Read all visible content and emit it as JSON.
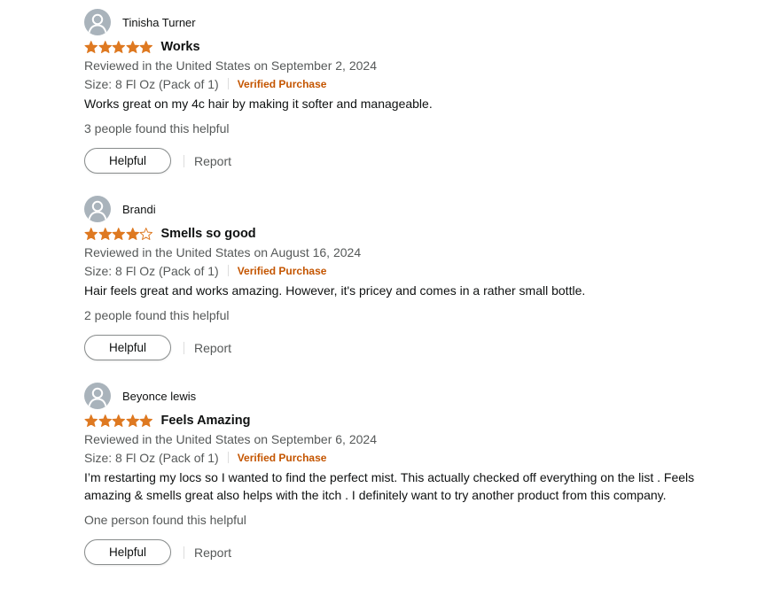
{
  "colors": {
    "star_fill": "#de7921",
    "verified": "#c45500",
    "avatar": "#a9b3bb",
    "secondary_text": "#565959"
  },
  "reviews": [
    {
      "profile_name": "Tinisha Turner",
      "avatar_icon": "user-silhouette-icon",
      "rating": 5,
      "title": "Works",
      "date": "Reviewed in the United States on September 2, 2024",
      "variant": "Size: 8 Fl Oz (Pack of 1)",
      "verified_label": "Verified Purchase",
      "body": "Works great on my 4c hair by making it softer and manageable.",
      "helpful_count": "3 people found this helpful",
      "helpful_label": "Helpful",
      "report_label": "Report"
    },
    {
      "profile_name": "Brandi",
      "avatar_icon": "user-silhouette-icon",
      "rating": 4,
      "title": "Smells so good",
      "date": "Reviewed in the United States on August 16, 2024",
      "variant": "Size: 8 Fl Oz (Pack of 1)",
      "verified_label": "Verified Purchase",
      "body": "Hair feels great and works amazing. However, it's pricey and comes in a rather small bottle.",
      "helpful_count": "2 people found this helpful",
      "helpful_label": "Helpful",
      "report_label": "Report"
    },
    {
      "profile_name": "Beyonce lewis",
      "avatar_icon": "user-silhouette-icon",
      "rating": 5,
      "title": "Feels Amazing",
      "date": "Reviewed in the United States on September 6, 2024",
      "variant": "Size: 8 Fl Oz (Pack of 1)",
      "verified_label": "Verified Purchase",
      "body": "I’m restarting my locs so I wanted to find the perfect mist. This actually checked off everything on the list . Feels amazing & smells great also helps with the itch . I definitely want to try another product from this company.",
      "helpful_count": "One person found this helpful",
      "helpful_label": "Helpful",
      "report_label": "Report"
    }
  ]
}
